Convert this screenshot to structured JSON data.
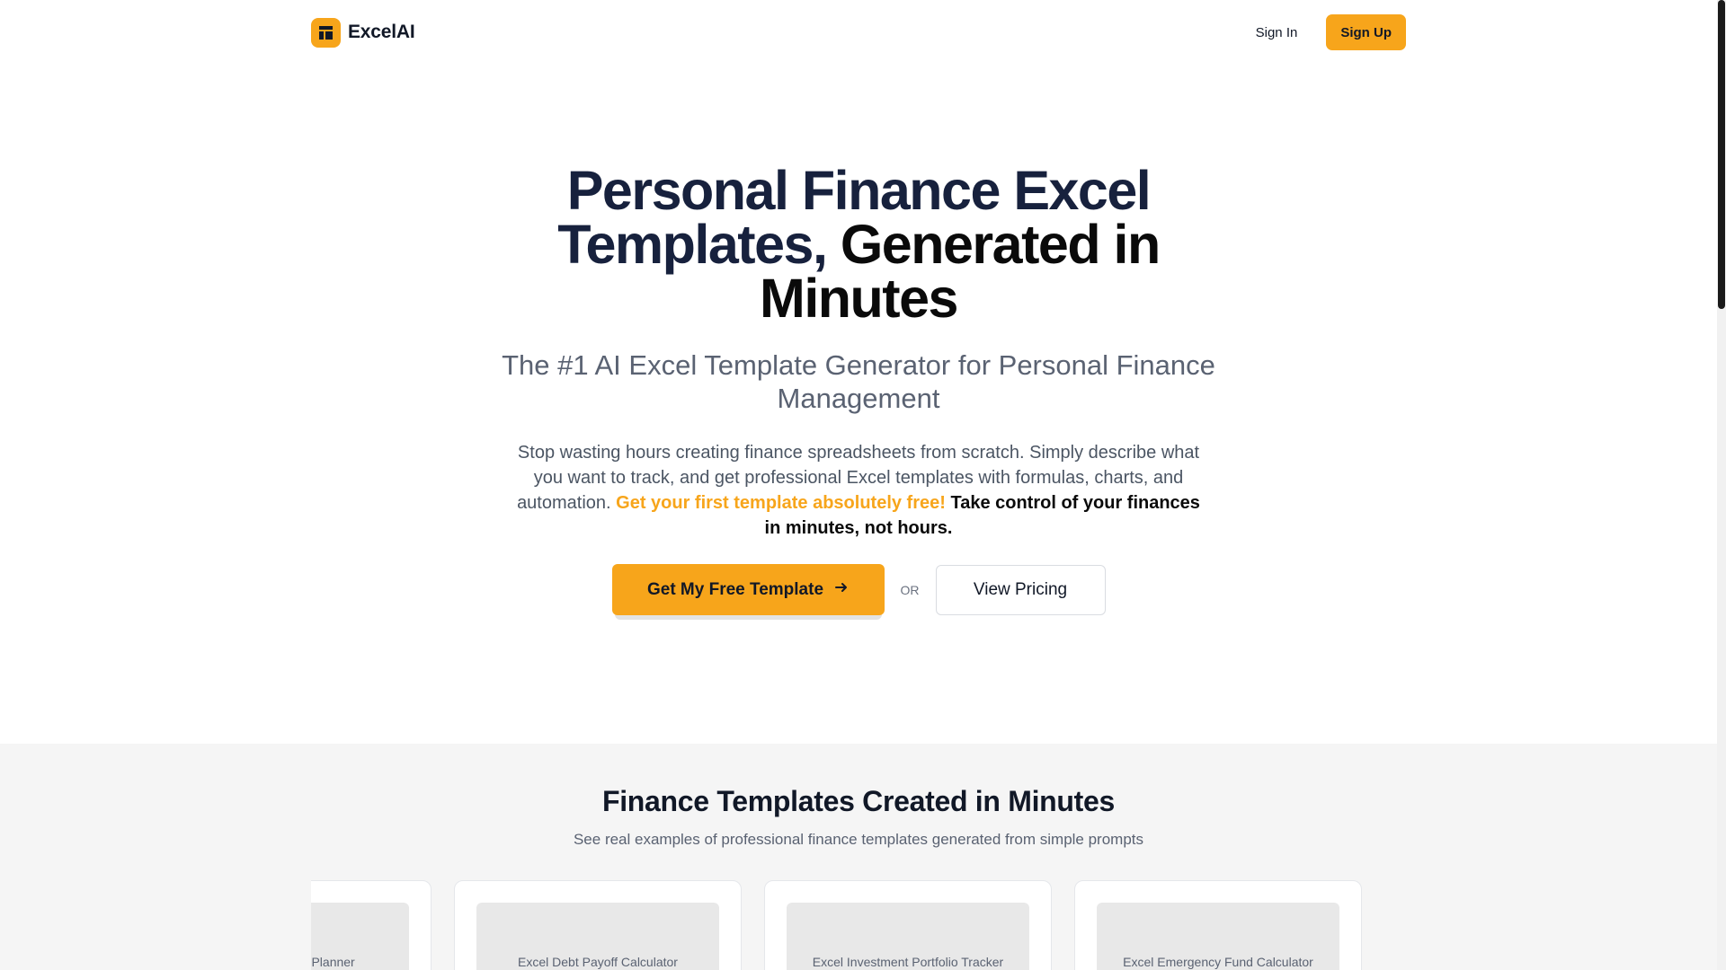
{
  "header": {
    "brand": "ExcelAI",
    "signin": "Sign In",
    "signup": "Sign Up"
  },
  "hero": {
    "title_part1": "Personal Finance Excel Templates,",
    "title_part2": " Generated in Minutes",
    "subtitle": "The #1 AI Excel Template Generator for Personal Finance Management",
    "desc_main": "Stop wasting hours creating finance spreadsheets from scratch. Simply describe what you want to track, and get professional Excel templates with formulas, charts, and automation. ",
    "desc_highlight": "Get your first template absolutely free!",
    "desc_strong": " Take control of your finances in minutes, not hours.",
    "cta_primary": "Get My Free Template",
    "or": "OR",
    "cta_secondary": "View Pricing"
  },
  "examples": {
    "title": "Finance Templates Created in Minutes",
    "subtitle": "See real examples of professional finance templates generated from simple prompts",
    "cards": [
      {
        "label": "Monthly Budget Planner"
      },
      {
        "label": "Excel Debt Payoff Calculator"
      },
      {
        "label": "Excel Investment Portfolio Tracker"
      },
      {
        "label": "Excel Emergency Fund Calculator"
      }
    ]
  },
  "colors": {
    "accent": "#f7a51b",
    "navy": "#17213d",
    "muted": "#5a6272"
  }
}
